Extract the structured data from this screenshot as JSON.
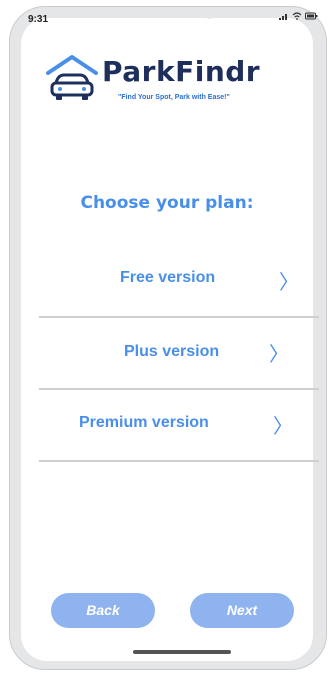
{
  "status_bar": {
    "time": "9:31",
    "icons": [
      "signal-icon",
      "wifi-icon",
      "battery-icon"
    ]
  },
  "brand": {
    "name": "ParkFindr",
    "tagline": "\"Find Your Spot, Park with Ease!\"",
    "logo_icon": "car-garage-icon",
    "colors": {
      "logo_dark": "#1f2f5c",
      "logo_blue": "#4a8fe7",
      "tagline": "#2b6fd6"
    }
  },
  "heading": "Choose your plan:",
  "plans": [
    {
      "label": "Free version",
      "chevron": "〉"
    },
    {
      "label": "Plus version",
      "chevron": "〉"
    },
    {
      "label": "Premium version",
      "chevron": "〉"
    }
  ],
  "buttons": {
    "back_label": "Back",
    "next_label": "Next"
  },
  "colors": {
    "accent": "#4a8fe7",
    "button_bg": "#8fb3ef",
    "divider": "#cfcfcf"
  }
}
